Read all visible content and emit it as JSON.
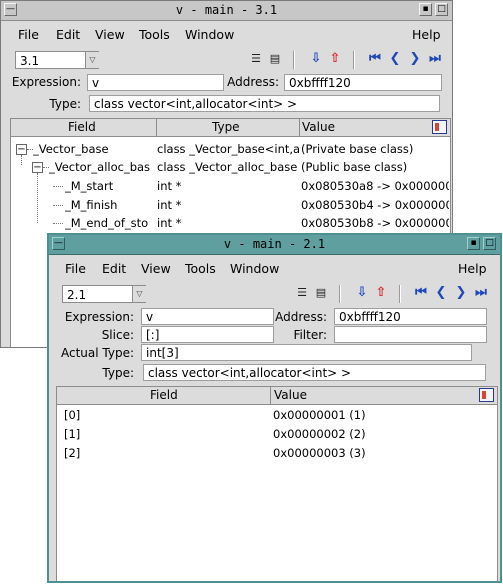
{
  "win1": {
    "title": "v - main - 3.1",
    "menus": [
      "File",
      "Edit",
      "View",
      "Tools",
      "Window",
      "Help"
    ],
    "combo_value": "3.1",
    "expression_label": "Expression:",
    "expression_value": "v",
    "address_label": "Address:",
    "address_value": "0xbffff120",
    "type_label": "Type:",
    "type_value": "class vector<int,allocator<int> >",
    "columns": [
      "Field",
      "Type",
      "Value"
    ],
    "rows": [
      {
        "field": "_Vector_base",
        "type": "class _Vector_base<int,a",
        "value": "(Private base class)"
      },
      {
        "field": "_Vector_alloc_bas",
        "type": "class _Vector_alloc_base",
        "value": "(Public base class)"
      },
      {
        "field": "_M_start",
        "type": "int *",
        "value": "0x080530a8 -> 0x000000"
      },
      {
        "field": "_M_finish",
        "type": "int *",
        "value": "0x080530b4 -> 0x000000"
      },
      {
        "field": "_M_end_of_sto",
        "type": "int *",
        "value": "0x080530b8 -> 0x000000"
      }
    ]
  },
  "win2": {
    "title": "v - main - 2.1",
    "menus": [
      "File",
      "Edit",
      "View",
      "Tools",
      "Window",
      "Help"
    ],
    "combo_value": "2.1",
    "expression_label": "Expression:",
    "expression_value": "v",
    "address_label": "Address:",
    "address_value": "0xbffff120",
    "slice_label": "Slice:",
    "slice_value": "[:]",
    "filter_label": "Filter:",
    "filter_value": "",
    "actual_type_label": "Actual Type:",
    "actual_type_value": "int[3]",
    "type_label": "Type:",
    "type_value": "class vector<int,allocator<int> >",
    "columns": [
      "Field",
      "Value"
    ],
    "rows": [
      {
        "field": "[0]",
        "value": "0x00000001 (1)"
      },
      {
        "field": "[1]",
        "value": "0x00000002 (2)"
      },
      {
        "field": "[2]",
        "value": "0x00000003 (3)"
      }
    ]
  },
  "colors": {
    "active_title": "#5f9f9f",
    "inactive_title": "#c7c7c7",
    "window_bg": "#dcdcdc"
  }
}
